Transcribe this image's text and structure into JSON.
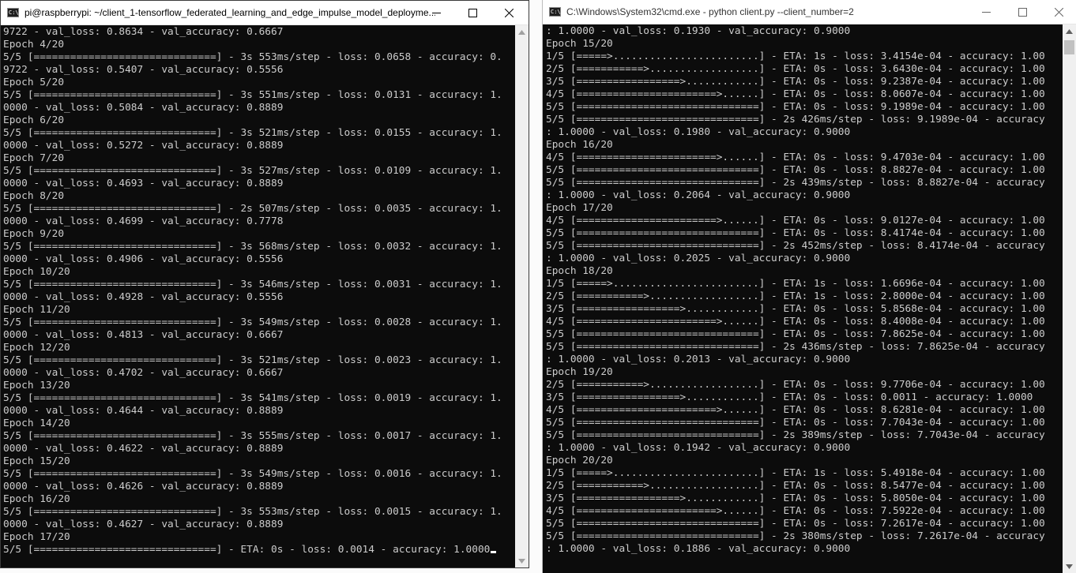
{
  "left_window": {
    "title": "pi@raspberrypi: ~/client_1-tensorflow_federated_learning_and_edge_impulse_model_deployme...",
    "icon": "terminal-icon",
    "lines": [
      "9722 - val_loss: 0.8634 - val_accuracy: 0.6667",
      "Epoch 4/20",
      "5/5 [==============================] - 3s 553ms/step - loss: 0.0658 - accuracy: 0.",
      "9722 - val_loss: 0.5407 - val_accuracy: 0.5556",
      "Epoch 5/20",
      "5/5 [==============================] - 3s 551ms/step - loss: 0.0131 - accuracy: 1.",
      "0000 - val_loss: 0.5084 - val_accuracy: 0.8889",
      "Epoch 6/20",
      "5/5 [==============================] - 3s 521ms/step - loss: 0.0155 - accuracy: 1.",
      "0000 - val_loss: 0.5272 - val_accuracy: 0.8889",
      "Epoch 7/20",
      "5/5 [==============================] - 3s 527ms/step - loss: 0.0109 - accuracy: 1.",
      "0000 - val_loss: 0.4693 - val_accuracy: 0.8889",
      "Epoch 8/20",
      "5/5 [==============================] - 2s 507ms/step - loss: 0.0035 - accuracy: 1.",
      "0000 - val_loss: 0.4699 - val_accuracy: 0.7778",
      "Epoch 9/20",
      "5/5 [==============================] - 3s 568ms/step - loss: 0.0032 - accuracy: 1.",
      "0000 - val_loss: 0.4906 - val_accuracy: 0.5556",
      "Epoch 10/20",
      "5/5 [==============================] - 3s 546ms/step - loss: 0.0031 - accuracy: 1.",
      "0000 - val_loss: 0.4928 - val_accuracy: 0.5556",
      "Epoch 11/20",
      "5/5 [==============================] - 3s 549ms/step - loss: 0.0028 - accuracy: 1.",
      "0000 - val_loss: 0.4813 - val_accuracy: 0.6667",
      "Epoch 12/20",
      "5/5 [==============================] - 3s 521ms/step - loss: 0.0023 - accuracy: 1.",
      "0000 - val_loss: 0.4702 - val_accuracy: 0.6667",
      "Epoch 13/20",
      "5/5 [==============================] - 3s 541ms/step - loss: 0.0019 - accuracy: 1.",
      "0000 - val_loss: 0.4644 - val_accuracy: 0.8889",
      "Epoch 14/20",
      "5/5 [==============================] - 3s 555ms/step - loss: 0.0017 - accuracy: 1.",
      "0000 - val_loss: 0.4622 - val_accuracy: 0.8889",
      "Epoch 15/20",
      "5/5 [==============================] - 3s 549ms/step - loss: 0.0016 - accuracy: 1.",
      "0000 - val_loss: 0.4626 - val_accuracy: 0.8889",
      "Epoch 16/20",
      "5/5 [==============================] - 3s 553ms/step - loss: 0.0015 - accuracy: 1.",
      "0000 - val_loss: 0.4627 - val_accuracy: 0.8889",
      "Epoch 17/20",
      "5/5 [==============================] - ETA: 0s - loss: 0.0014 - accuracy: 1.0000"
    ]
  },
  "right_window": {
    "title": "C:\\Windows\\System32\\cmd.exe - python  client.py --client_number=2",
    "icon": "cmd-icon",
    "lines": [
      ": 1.0000 - val_loss: 0.1930 - val_accuracy: 0.9000",
      "Epoch 15/20",
      "1/5 [=====>........................] - ETA: 1s - loss: 3.4154e-04 - accuracy: 1.00",
      "2/5 [===========>..................] - ETA: 0s - loss: 3.6430e-04 - accuracy: 1.00",
      "3/5 [=================>............] - ETA: 0s - loss: 9.2387e-04 - accuracy: 1.00",
      "4/5 [=======================>......] - ETA: 0s - loss: 8.0607e-04 - accuracy: 1.00",
      "5/5 [==============================] - ETA: 0s - loss: 9.1989e-04 - accuracy: 1.00",
      "5/5 [==============================] - 2s 426ms/step - loss: 9.1989e-04 - accuracy",
      ": 1.0000 - val_loss: 0.1980 - val_accuracy: 0.9000",
      "Epoch 16/20",
      "4/5 [=======================>......] - ETA: 0s - loss: 9.4703e-04 - accuracy: 1.00",
      "5/5 [==============================] - ETA: 0s - loss: 8.8827e-04 - accuracy: 1.00",
      "5/5 [==============================] - 2s 439ms/step - loss: 8.8827e-04 - accuracy",
      ": 1.0000 - val_loss: 0.2064 - val_accuracy: 0.9000",
      "Epoch 17/20",
      "4/5 [=======================>......] - ETA: 0s - loss: 9.0127e-04 - accuracy: 1.00",
      "5/5 [==============================] - ETA: 0s - loss: 8.4174e-04 - accuracy: 1.00",
      "5/5 [==============================] - 2s 452ms/step - loss: 8.4174e-04 - accuracy",
      ": 1.0000 - val_loss: 0.2025 - val_accuracy: 0.9000",
      "Epoch 18/20",
      "1/5 [=====>........................] - ETA: 1s - loss: 1.6696e-04 - accuracy: 1.00",
      "2/5 [===========>..................] - ETA: 1s - loss: 2.8000e-04 - accuracy: 1.00",
      "3/5 [=================>............] - ETA: 0s - loss: 5.8568e-04 - accuracy: 1.00",
      "4/5 [=======================>......] - ETA: 0s - loss: 8.4008e-04 - accuracy: 1.00",
      "5/5 [==============================] - ETA: 0s - loss: 7.8625e-04 - accuracy: 1.00",
      "5/5 [==============================] - 2s 436ms/step - loss: 7.8625e-04 - accuracy",
      ": 1.0000 - val_loss: 0.2013 - val_accuracy: 0.9000",
      "Epoch 19/20",
      "2/5 [===========>..................] - ETA: 0s - loss: 9.7706e-04 - accuracy: 1.00",
      "3/5 [=================>............] - ETA: 0s - loss: 0.0011 - accuracy: 1.0000",
      "4/5 [=======================>......] - ETA: 0s - loss: 8.6281e-04 - accuracy: 1.00",
      "5/5 [==============================] - ETA: 0s - loss: 7.7043e-04 - accuracy: 1.00",
      "5/5 [==============================] - 2s 389ms/step - loss: 7.7043e-04 - accuracy",
      ": 1.0000 - val_loss: 0.1942 - val_accuracy: 0.9000",
      "Epoch 20/20",
      "1/5 [=====>........................] - ETA: 1s - loss: 5.4918e-04 - accuracy: 1.00",
      "2/5 [===========>..................] - ETA: 0s - loss: 8.5477e-04 - accuracy: 1.00",
      "3/5 [=================>............] - ETA: 0s - loss: 5.8050e-04 - accuracy: 1.00",
      "4/5 [=======================>......] - ETA: 0s - loss: 7.5922e-04 - accuracy: 1.00",
      "5/5 [==============================] - ETA: 0s - loss: 7.2617e-04 - accuracy: 1.00",
      "5/5 [==============================] - 2s 380ms/step - loss: 7.2617e-04 - accuracy",
      ": 1.0000 - val_loss: 0.1886 - val_accuracy: 0.9000"
    ]
  },
  "colors": {
    "console_bg": "#0c0c0c",
    "console_text": "#cccccc",
    "titlebar_bg": "#ffffff",
    "scrollbar_track": "#f0f0f0",
    "scrollbar_thumb": "#c1c1c1"
  },
  "icons": {
    "minimize": "minimize-icon",
    "maximize": "maximize-icon",
    "close": "close-icon",
    "scroll_up": "scroll-up-arrow-icon",
    "scroll_down": "scroll-down-arrow-icon"
  }
}
